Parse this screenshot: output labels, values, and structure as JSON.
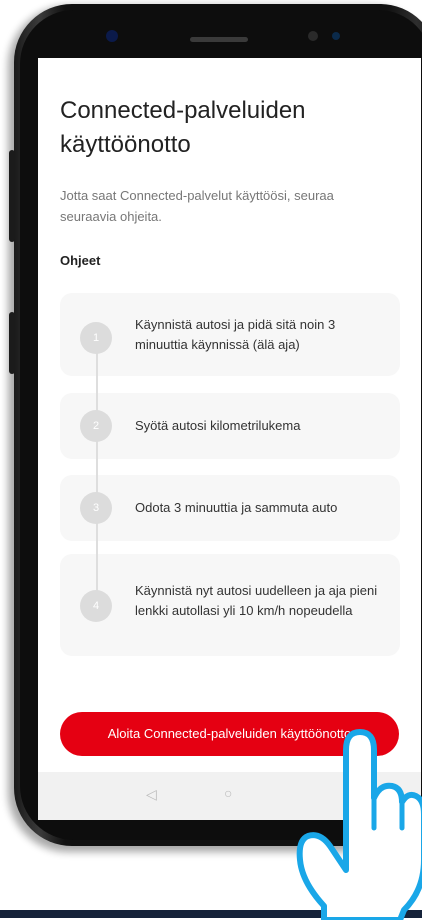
{
  "app": {
    "title": "Connected-palveluiden käyttöönotto",
    "subtitle": "Jotta saat Connected-palvelut käyttöösi, seuraa seuraavia ohjeita.",
    "section_label": "Ohjeet",
    "steps": [
      {
        "number": "1",
        "text": "Käynnistä autosi ja pidä sitä noin 3 minuuttia käynnissä (älä aja)"
      },
      {
        "number": "2",
        "text": "Syötä autosi kilometrilukema"
      },
      {
        "number": "3",
        "text": "Odota 3 minuuttia ja sammuta auto"
      },
      {
        "number": "4",
        "text": "Käynnistä nyt autosi uudelleen ja aja pieni lenkki autollasi yli 10 km/h nopeudella"
      }
    ],
    "cta_label": "Aloita Connected-palveluiden käyttöönotto"
  },
  "navbar": {
    "back_icon": "◁",
    "home_icon": "○"
  },
  "colors": {
    "accent": "#e50012",
    "hand_stroke": "#1aa7e8",
    "step_bg": "#f7f7f7"
  }
}
